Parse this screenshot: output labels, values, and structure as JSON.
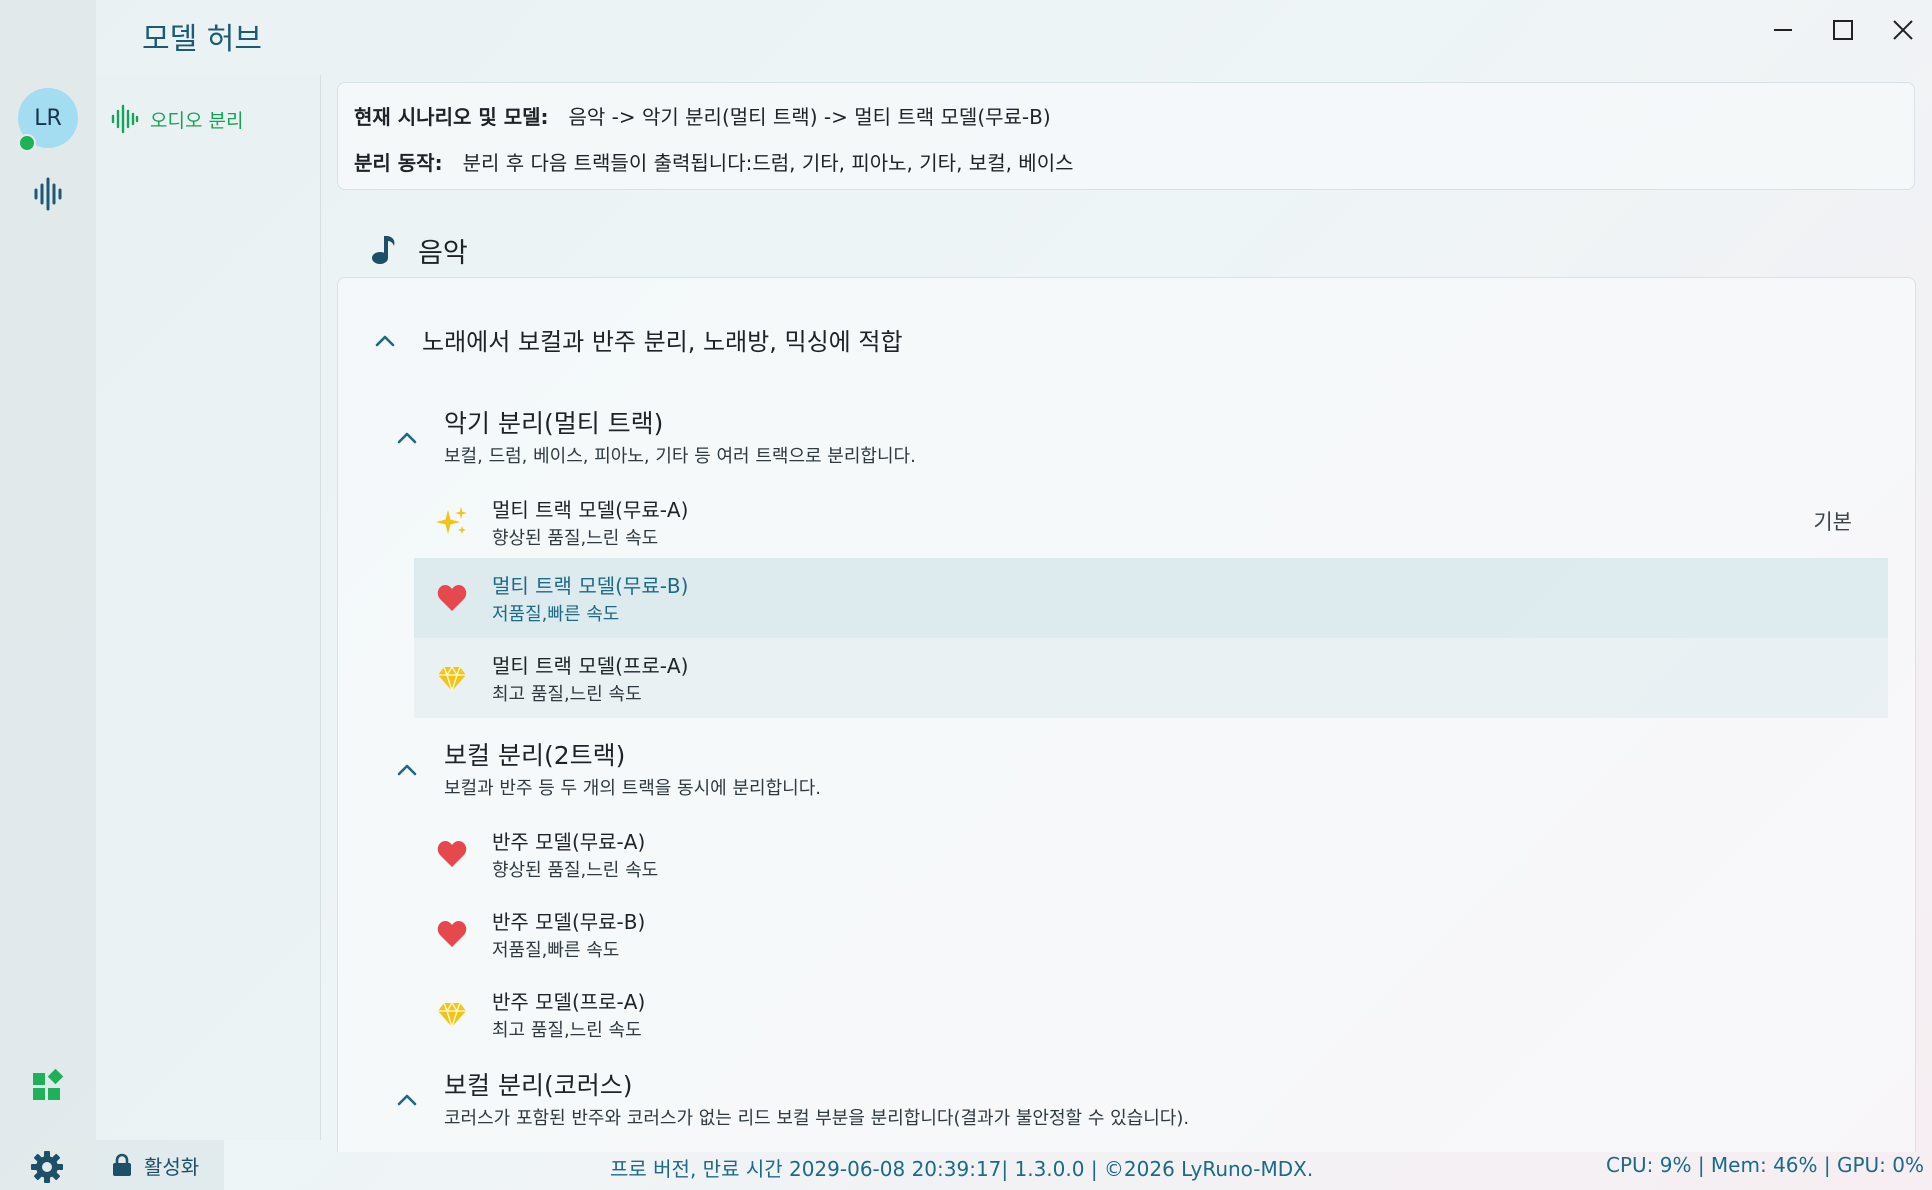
{
  "window": {
    "title": "모델 허브"
  },
  "user": {
    "initials": "LR",
    "online": true
  },
  "nav": {
    "item_label": "오디오 분리"
  },
  "scenario_info": {
    "scenario_key": "현재 시나리오 및 모델:",
    "scenario_value": "음악 -> 악기 분리(멀티 트랙) -> 멀티 트랙 모델(무료-B)",
    "action_key": "분리 동작:",
    "action_value": "분리 후 다음 트랙들이 출력됩니다:드럼, 기타, 피아노, 기타, 보컬, 베이스"
  },
  "section": {
    "title": "음악",
    "icon": "music-note-icon"
  },
  "scenario": {
    "title": "노래에서 보컬과 반주 분리, 노래방, 믹싱에 적합"
  },
  "groups": [
    {
      "title": "악기 분리(멀티 트랙)",
      "desc": "보컬, 드럼, 베이스, 피아노, 기타 등 여러 트랙으로 분리합니다.",
      "models": [
        {
          "name": "멀티 트랙 모델(무료-A)",
          "desc": "향상된 품질,느린 속도",
          "icon": "sparkle-icon",
          "tag": "기본"
        },
        {
          "name": "멀티 트랙 모델(무료-B)",
          "desc": "저품질,빠른 속도",
          "icon": "heart-icon"
        },
        {
          "name": "멀티 트랙 모델(프로-A)",
          "desc": "최고 품질,느린 속도",
          "icon": "diamond-icon"
        }
      ]
    },
    {
      "title": "보컬 분리(2트랙)",
      "desc": "보컬과 반주 등 두 개의 트랙을 동시에 분리합니다.",
      "models": [
        {
          "name": "반주 모델(무료-A)",
          "desc": "향상된 품질,느린 속도",
          "icon": "heart-icon"
        },
        {
          "name": "반주 모델(무료-B)",
          "desc": "저품질,빠른 속도",
          "icon": "heart-icon"
        },
        {
          "name": "반주 모델(프로-A)",
          "desc": "최고 품질,느린 속도",
          "icon": "diamond-icon"
        }
      ]
    },
    {
      "title": "보컬 분리(코러스)",
      "desc": "코러스가 포함된 반주와 코러스가 없는 리드 보컬 부분을 분리합니다(결과가 불안정할 수 있습니다)."
    }
  ],
  "status": {
    "activate_label": "활성화",
    "center_text": "프로 버전, 만료 시간 2029-06-08 20:39:17| 1.3.0.0 | ©2026 LyRuno-MDX.",
    "right_text": "CPU: 9% | Mem: 46% | GPU: 0%"
  },
  "colors": {
    "accent_green": "#15a356",
    "accent_teal": "#1c6a86",
    "heart_red": "#e5484d",
    "gold": "#f2c417",
    "avatar_bg": "#a4dcf1"
  }
}
